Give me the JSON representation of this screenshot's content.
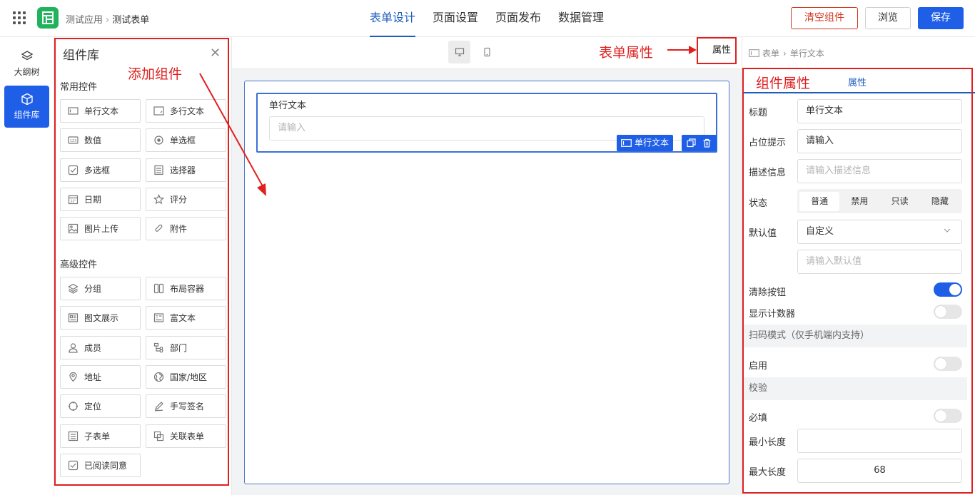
{
  "header": {
    "breadcrumb": [
      "测试应用",
      "测试表单"
    ],
    "tabs": [
      {
        "label": "表单设计",
        "active": true
      },
      {
        "label": "页面设置",
        "active": false
      },
      {
        "label": "页面发布",
        "active": false
      },
      {
        "label": "数据管理",
        "active": false
      }
    ],
    "clear_label": "清空组件",
    "preview_label": "浏览",
    "save_label": "保存"
  },
  "rail": {
    "items": [
      {
        "label": "大纲树",
        "icon": "layers-icon",
        "active": false
      },
      {
        "label": "组件库",
        "icon": "cube-icon",
        "active": true
      }
    ]
  },
  "library": {
    "title": "组件库",
    "annotation": "添加组件",
    "common_title": "常用控件",
    "common": [
      {
        "label": "单行文本",
        "icon": "single-line-icon"
      },
      {
        "label": "多行文本",
        "icon": "multi-line-icon"
      },
      {
        "label": "数值",
        "icon": "number-icon"
      },
      {
        "label": "单选框",
        "icon": "radio-icon"
      },
      {
        "label": "多选框",
        "icon": "checkbox-icon"
      },
      {
        "label": "选择器",
        "icon": "select-icon"
      },
      {
        "label": "日期",
        "icon": "calendar-icon"
      },
      {
        "label": "评分",
        "icon": "star-icon"
      },
      {
        "label": "图片上传",
        "icon": "image-icon"
      },
      {
        "label": "附件",
        "icon": "paperclip-icon"
      }
    ],
    "advanced_title": "高级控件",
    "advanced": [
      {
        "label": "分组",
        "icon": "layers-icon"
      },
      {
        "label": "布局容器",
        "icon": "columns-icon"
      },
      {
        "label": "图文展示",
        "icon": "media-icon"
      },
      {
        "label": "富文本",
        "icon": "richtext-icon"
      },
      {
        "label": "成员",
        "icon": "user-icon"
      },
      {
        "label": "部门",
        "icon": "tree-icon"
      },
      {
        "label": "地址",
        "icon": "map-pin-icon"
      },
      {
        "label": "国家/地区",
        "icon": "globe-icon"
      },
      {
        "label": "定位",
        "icon": "crosshair-icon"
      },
      {
        "label": "手写签名",
        "icon": "pen-icon"
      },
      {
        "label": "子表单",
        "icon": "subform-icon"
      },
      {
        "label": "关联表单",
        "icon": "link-form-icon"
      },
      {
        "label": "已阅读同意",
        "icon": "check-square-icon"
      }
    ]
  },
  "canvas": {
    "devices": [
      {
        "name": "desktop-icon",
        "active": true
      },
      {
        "name": "mobile-icon",
        "active": false
      }
    ],
    "form_attr_label": "属性",
    "form_attr_annotation": "表单属性",
    "field": {
      "label": "单行文本",
      "placeholder": "请输入",
      "tag": "单行文本"
    }
  },
  "props": {
    "breadcrumb": [
      "表单",
      "单行文本"
    ],
    "title_annotation": "组件属性",
    "tab": "属性",
    "title_label": "标题",
    "title_value": "单行文本",
    "placeholder_label": "占位提示",
    "placeholder_value": "请输入",
    "desc_label": "描述信息",
    "desc_placeholder": "请输入描述信息",
    "state_label": "状态",
    "states": [
      {
        "label": "普通",
        "active": true
      },
      {
        "label": "禁用",
        "active": false
      },
      {
        "label": "只读",
        "active": false
      },
      {
        "label": "隐藏",
        "active": false
      }
    ],
    "default_label": "默认值",
    "default_mode": "自定义",
    "default_placeholder": "请输入默认值",
    "clear_btn_label": "清除按钮",
    "clear_btn_on": true,
    "counter_label": "显示计数器",
    "counter_on": false,
    "scan_group": "扫码模式（仅手机端内支持）",
    "enable_label": "启用",
    "enable_on": false,
    "validate_group": "校验",
    "required_label": "必填",
    "required_on": false,
    "min_len_label": "最小长度",
    "min_len_value": "",
    "max_len_label": "最大长度",
    "max_len_value": "68"
  },
  "colors": {
    "accent": "#1f5fe8",
    "annotation": "#e02020",
    "app_logo": "#21b35b"
  }
}
